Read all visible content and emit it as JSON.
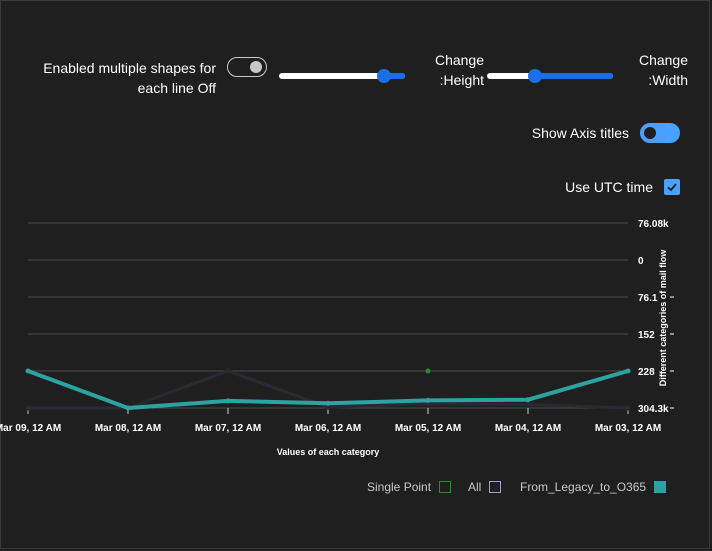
{
  "controls": {
    "multiple_shapes_label": "Enabled multiple shapes for each line Off",
    "multiple_shapes_on": false,
    "height_label": "Change :Height",
    "height_value": 0.83,
    "width_label": "Change :Width",
    "width_value": 0.38,
    "axis_titles_label": "Show Axis titles",
    "axis_titles_on": true,
    "utc_label": "Use UTC time",
    "utc_checked": true
  },
  "chart_data": {
    "type": "line",
    "x": [
      "Mar 09, 12 AM",
      "Mar 08, 12 AM",
      "Mar 07, 12 AM",
      "Mar 06, 12 AM",
      "Mar 05, 12 AM",
      "Mar 04, 12 AM",
      "Mar 03, 12 AM"
    ],
    "xlabel": "Values of each category",
    "ylabel": "Different categories of mail flow",
    "y_ticks": [
      "76.08k",
      "0",
      "76.1",
      "152",
      "228",
      "304.3k"
    ],
    "y_axis_position": "right",
    "y_reversed": true,
    "ylim": [
      -76080,
      304300
    ],
    "grid": true,
    "legend_position": "bottom-right",
    "series": [
      {
        "name": "Single Point",
        "color": "#2e8b2e",
        "x": [
          "Mar 05, 12 AM"
        ],
        "values": [
          228
        ]
      },
      {
        "name": "All",
        "color": "#2a2833",
        "x": [
          "Mar 09, 12 AM",
          "Mar 08, 12 AM",
          "Mar 07, 12 AM",
          "Mar 06, 12 AM",
          "Mar 05, 12 AM",
          "Mar 04, 12 AM",
          "Mar 03, 12 AM"
        ],
        "values": [
          304000,
          304000,
          228,
          298000,
          270000,
          276000,
          304000
        ]
      },
      {
        "name": "From_Legacy_to_O365",
        "color": "#2ba3a3",
        "x": [
          "Mar 09, 12 AM",
          "Mar 08, 12 AM",
          "Mar 07, 12 AM",
          "Mar 06, 12 AM",
          "Mar 05, 12 AM",
          "Mar 04, 12 AM",
          "Mar 03, 12 AM"
        ],
        "values": [
          228,
          304000,
          246000,
          265000,
          242000,
          236000,
          228
        ]
      }
    ]
  }
}
